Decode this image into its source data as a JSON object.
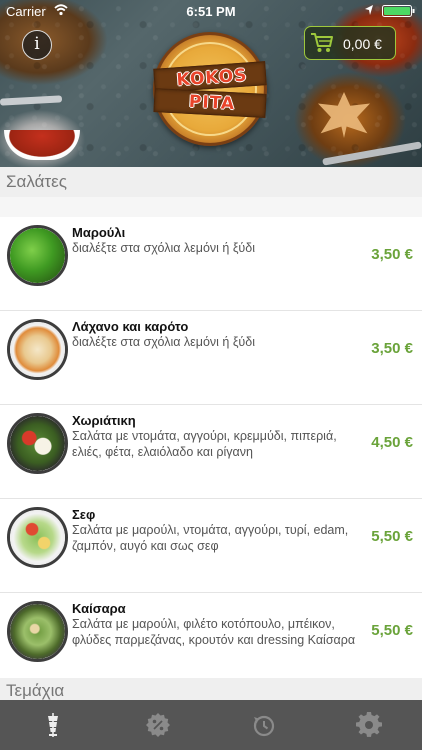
{
  "status_bar": {
    "carrier": "Carrier",
    "time": "6:51 PM",
    "icons": [
      "wifi-icon",
      "location-icon",
      "battery-icon"
    ]
  },
  "header": {
    "info_button_glyph": "i",
    "cart_total": "0,00 €",
    "logo_line1": "KOKOS",
    "logo_line2": "PITA"
  },
  "sections": [
    {
      "title": "Σαλάτες"
    },
    {
      "title": "Τεμάχια"
    }
  ],
  "items": [
    {
      "name": "Μαρούλι",
      "description": "διαλέξτε στα σχόλια λεμόνι ή ξύδι",
      "price": "3,50 €"
    },
    {
      "name": "Λάχανο και καρότο",
      "description": "διαλέξτε στα σχόλια λεμόνι ή ξύδι",
      "price": "3,50 €"
    },
    {
      "name": "Χωριάτικη",
      "description": "Σαλάτα με ντομάτα, αγγούρι, κρεμμύδι, πιπεριά, ελιές, φέτα, ελαιόλαδο και ρίγανη",
      "price": "4,50 €"
    },
    {
      "name": "Σεφ",
      "description": "Σαλάτα με μαρούλι, ντομάτα, αγγούρι, τυρί, edam, ζαμπόν, αυγό και σως σεφ",
      "price": "5,50 €"
    },
    {
      "name": "Καίσαρα",
      "description": "Σαλάτα με μαρούλι, φιλέτο κοτόπουλο, μπέικον, φλύδες παρμεζάνας, κρουτόν και dressing Καίσαρα",
      "price": "5,50 €"
    }
  ],
  "tabbar": {
    "tabs": [
      {
        "icon": "gyro-icon",
        "active": true
      },
      {
        "icon": "discount-icon",
        "active": false
      },
      {
        "icon": "history-icon",
        "active": false
      },
      {
        "icon": "settings-icon",
        "active": false
      }
    ]
  },
  "colors": {
    "price": "#6aa33a",
    "tabbar_bg": "#555555",
    "section_bg": "#efefef",
    "cart_border": "#9ec83c"
  }
}
